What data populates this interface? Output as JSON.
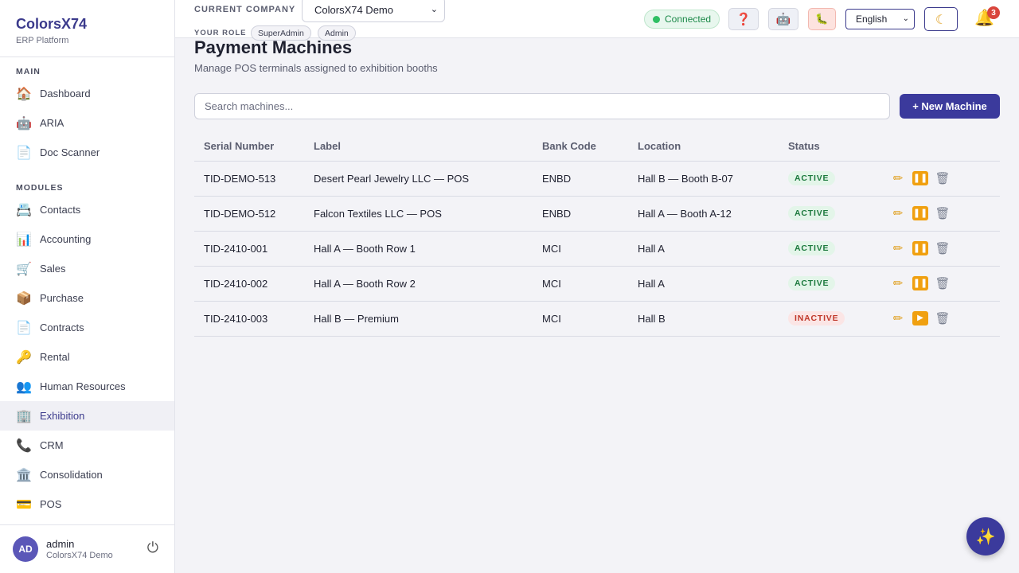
{
  "brand": {
    "title": "ColorsX74",
    "subtitle": "ERP Platform"
  },
  "sidebar": {
    "main_label": "MAIN",
    "main_items": [
      {
        "label": "Dashboard",
        "icon": "home-icon",
        "glyph": "🏠"
      },
      {
        "label": "ARIA",
        "icon": "robot-icon",
        "glyph": "🤖"
      },
      {
        "label": "Doc Scanner",
        "icon": "document-icon",
        "glyph": "📄"
      }
    ],
    "modules_label": "MODULES",
    "module_items": [
      {
        "label": "Contacts",
        "icon": "contact-card-icon",
        "glyph": "📇"
      },
      {
        "label": "Accounting",
        "icon": "bar-chart-icon",
        "glyph": "📊"
      },
      {
        "label": "Sales",
        "icon": "cart-icon",
        "glyph": "🛒"
      },
      {
        "label": "Purchase",
        "icon": "package-icon",
        "glyph": "📦"
      },
      {
        "label": "Contracts",
        "icon": "document-icon",
        "glyph": "📄"
      },
      {
        "label": "Rental",
        "icon": "key-icon",
        "glyph": "🔑"
      },
      {
        "label": "Human Resources",
        "icon": "people-icon",
        "glyph": "👥"
      },
      {
        "label": "Exhibition",
        "icon": "building-icon",
        "glyph": "🏢"
      },
      {
        "label": "CRM",
        "icon": "phone-icon",
        "glyph": "📞"
      },
      {
        "label": "Consolidation",
        "icon": "bank-icon",
        "glyph": "🏛️"
      },
      {
        "label": "POS",
        "icon": "credit-card-icon",
        "glyph": "💳"
      }
    ],
    "active_item": "Exhibition"
  },
  "user": {
    "initials": "AD",
    "name": "admin",
    "company": "ColorsX74 Demo"
  },
  "topbar": {
    "company_label": "CURRENT COMPANY",
    "company_value": "ColorsX74 Demo",
    "role_label": "YOUR ROLE",
    "roles": [
      "SuperAdmin",
      "Admin"
    ],
    "connection_status": "Connected",
    "language": "English",
    "notification_count": "3"
  },
  "page": {
    "title": "Payment Machines",
    "subtitle": "Manage POS terminals assigned to exhibition booths",
    "search_placeholder": "Search machines...",
    "new_button": "+ New Machine"
  },
  "table": {
    "columns": [
      "Serial Number",
      "Label",
      "Bank Code",
      "Location",
      "Status"
    ],
    "rows": [
      {
        "serial": "TID-DEMO-513",
        "label": "Desert Pearl Jewelry LLC — POS",
        "bank": "ENBD",
        "location": "Hall B — Booth B-07",
        "status": "ACTIVE"
      },
      {
        "serial": "TID-DEMO-512",
        "label": "Falcon Textiles LLC — POS",
        "bank": "ENBD",
        "location": "Hall A — Booth A-12",
        "status": "ACTIVE"
      },
      {
        "serial": "TID-2410-001",
        "label": "Hall A — Booth Row 1",
        "bank": "MCI",
        "location": "Hall A",
        "status": "ACTIVE"
      },
      {
        "serial": "TID-2410-002",
        "label": "Hall A — Booth Row 2",
        "bank": "MCI",
        "location": "Hall A",
        "status": "ACTIVE"
      },
      {
        "serial": "TID-2410-003",
        "label": "Hall B — Premium",
        "bank": "MCI",
        "location": "Hall B",
        "status": "INACTIVE"
      }
    ]
  },
  "colors": {
    "accent": "#3b3a9c",
    "active_badge": "#1d7a3e",
    "inactive_badge": "#c0392b",
    "connected": "#2fbf64"
  }
}
